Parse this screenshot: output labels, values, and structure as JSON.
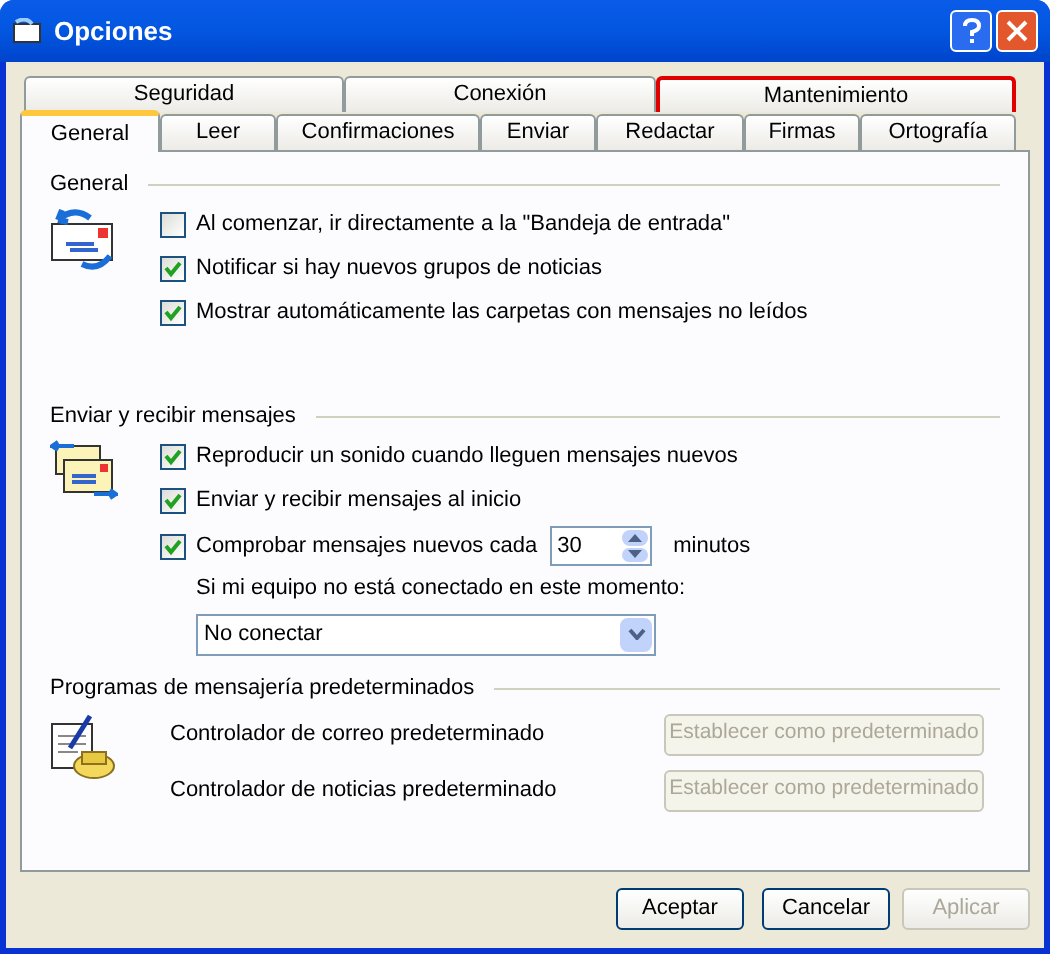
{
  "window": {
    "title": "Opciones"
  },
  "tab_rows": [
    [
      {
        "label": "Seguridad",
        "selected": false,
        "highlighted": false
      },
      {
        "label": "Conexión",
        "selected": false,
        "highlighted": false
      },
      {
        "label": "Mantenimiento",
        "selected": false,
        "highlighted": true
      }
    ],
    [
      {
        "label": "General",
        "selected": true,
        "highlighted": false
      },
      {
        "label": "Leer",
        "selected": false,
        "highlighted": false
      },
      {
        "label": "Confirmaciones",
        "selected": false,
        "highlighted": false
      },
      {
        "label": "Enviar",
        "selected": false,
        "highlighted": false
      },
      {
        "label": "Redactar",
        "selected": false,
        "highlighted": false
      },
      {
        "label": "Firmas",
        "selected": false,
        "highlighted": false
      },
      {
        "label": "Ortografía",
        "selected": false,
        "highlighted": false
      }
    ]
  ],
  "sections": [
    {
      "title": "General",
      "items": [
        {
          "kind": "checkbox",
          "label": "Al comenzar, ir directamente a la \"Bandeja de entrada\"",
          "checked": false
        },
        {
          "kind": "checkbox",
          "label": "Notificar si hay nuevos grupos de noticias",
          "checked": true
        },
        {
          "kind": "checkbox",
          "label": "Mostrar automáticamente las carpetas con mensajes no leídos",
          "checked": true
        }
      ]
    },
    {
      "title": "Enviar y recibir mensajes",
      "items": [
        {
          "kind": "checkbox",
          "label": "Reproducir un sonido cuando lleguen mensajes nuevos",
          "checked": true
        },
        {
          "kind": "checkbox",
          "label": "Enviar y recibir mensajes al inicio",
          "checked": true
        },
        {
          "kind": "spin_checkbox",
          "label": "Comprobar mensajes nuevos cada",
          "checked": true,
          "value": "30",
          "unit": "minutos"
        },
        {
          "kind": "label",
          "label": "Si mi equipo no está conectado en este momento:"
        },
        {
          "kind": "dropdown",
          "value": "No conectar"
        }
      ]
    },
    {
      "title": "Programas de mensajería predeterminados",
      "items": [
        {
          "kind": "button_row",
          "label": "Controlador de correo predeterminado",
          "button": "Establecer como predeterminado",
          "disabled": true
        },
        {
          "kind": "button_row",
          "label": "Controlador de noticias predeterminado",
          "button": "Establecer como predeterminado",
          "disabled": true
        }
      ]
    }
  ],
  "buttons": [
    {
      "label": "Aceptar",
      "disabled": false
    },
    {
      "label": "Cancelar",
      "disabled": false
    },
    {
      "label": "Aplicar",
      "disabled": true
    }
  ]
}
